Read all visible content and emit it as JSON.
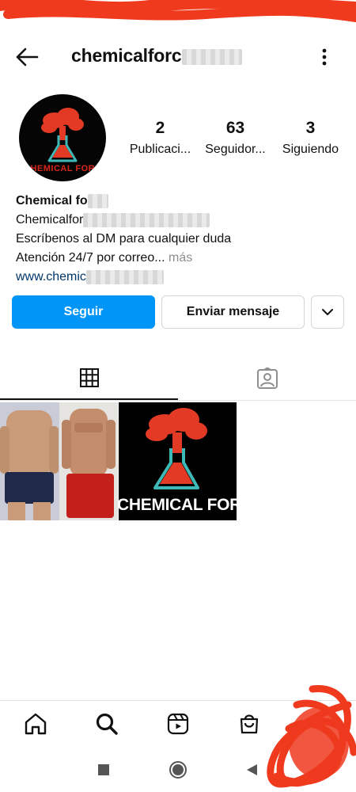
{
  "profile": {
    "username": "chemicalforc",
    "display_name": "Chemical fo",
    "brand_text": "CHEMICAL FORC",
    "bio_lines": [
      "Chemicalfor",
      "Escríbenos al DM para cualquier duda",
      "Atención 24/7 por correo..."
    ],
    "bio_more": "más",
    "website": "www.chemic"
  },
  "stats": [
    {
      "value": "2",
      "label": "Publicaci..."
    },
    {
      "value": "63",
      "label": "Seguidor..."
    },
    {
      "value": "3",
      "label": "Siguiendo"
    }
  ],
  "actions": {
    "follow": "Seguir",
    "message": "Enviar mensaje"
  },
  "tabs": [
    {
      "icon": "grid-icon",
      "active": true
    },
    {
      "icon": "tagged-person-icon",
      "active": false
    }
  ],
  "bottom_nav": [
    "home-icon",
    "search-icon",
    "reels-icon",
    "shop-icon"
  ],
  "system_nav": [
    "recent-apps-icon",
    "home-circle-icon",
    "back-triangle-icon"
  ],
  "colors": {
    "accent": "#0095f6",
    "brand_red": "#e23a24",
    "flask_teal": "#3fb9b8",
    "censor_red": "#ef3a1e"
  }
}
